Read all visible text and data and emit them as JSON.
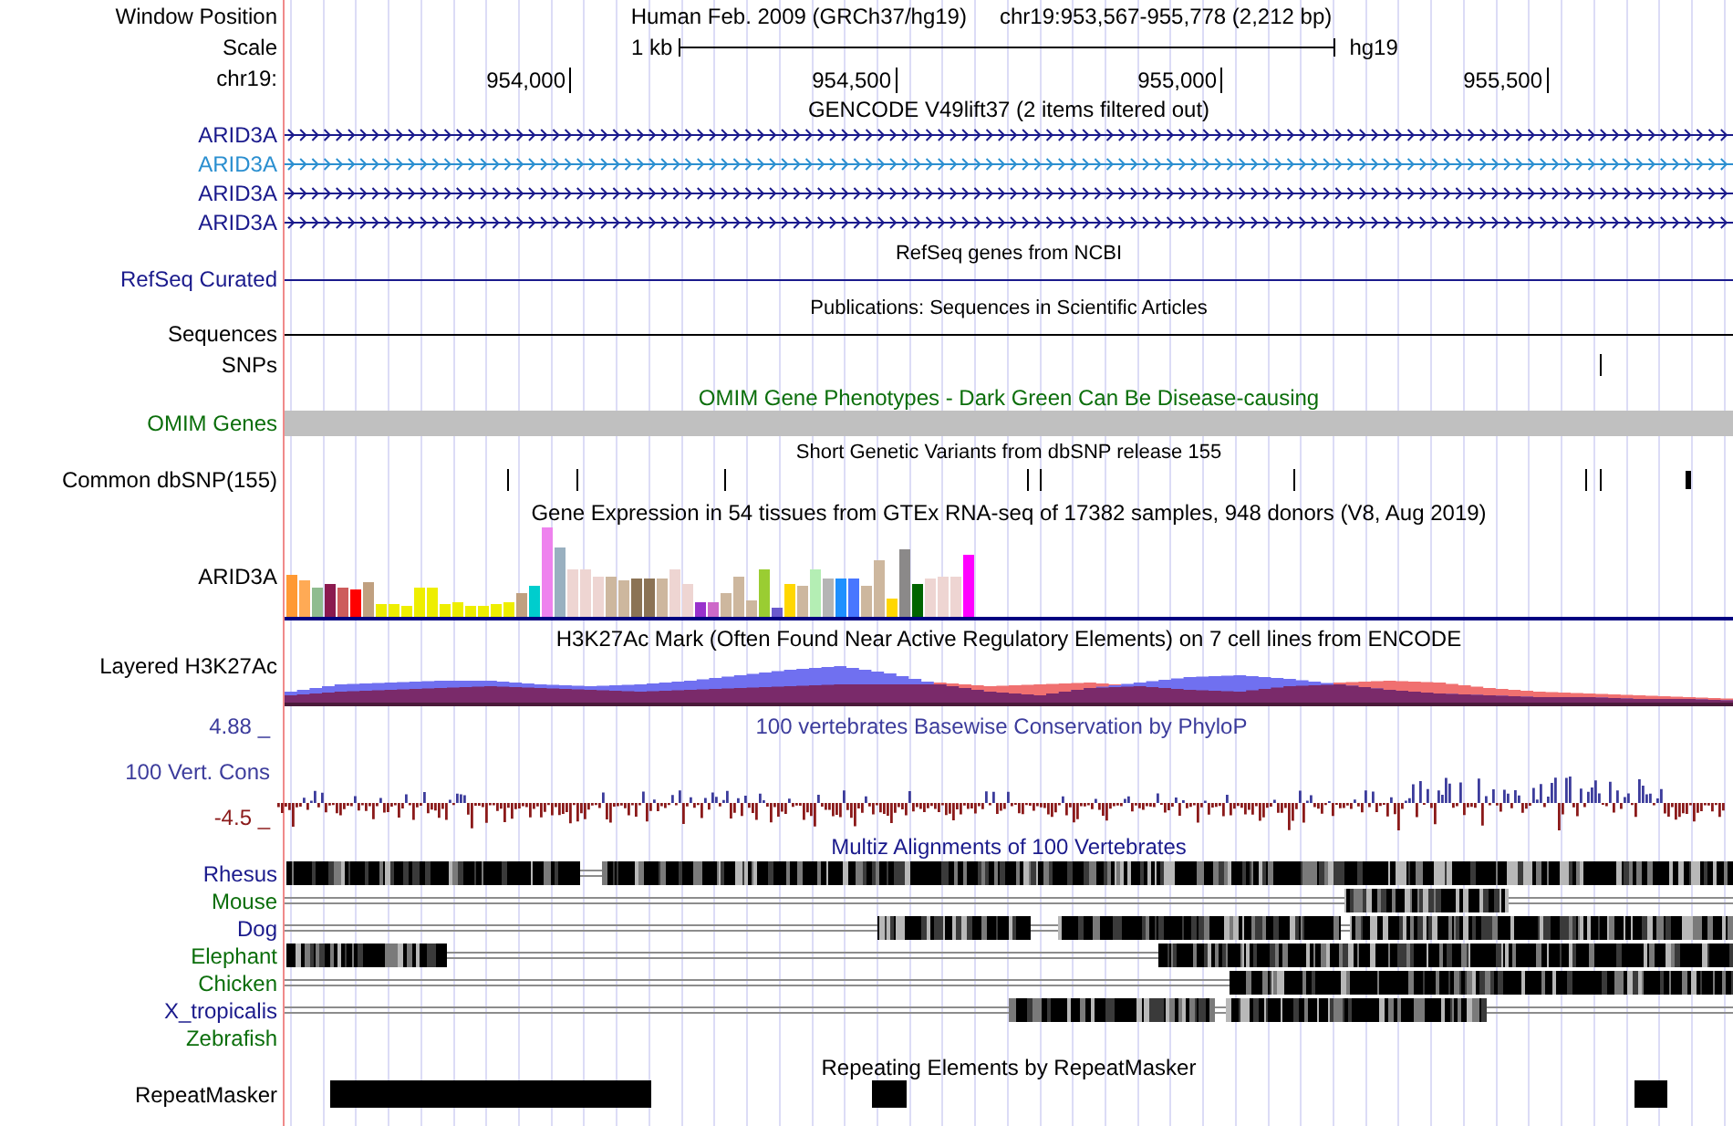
{
  "header": {
    "position_label": "Window Position",
    "assembly": "Human Feb. 2009 (GRCh37/hg19)",
    "position": "chr19:953,567-955,778 (2,212 bp)",
    "scale_label": "Scale",
    "scale_length": "1 kb",
    "scale_assembly": "hg19",
    "chrom_label": "chr19:",
    "ticks": [
      "954,000",
      "954,500",
      "955,000",
      "955,500"
    ]
  },
  "tracks": [
    {
      "kind": "genes",
      "title": "GENCODE V49lift37 (2 items filtered out)",
      "items": [
        {
          "label": "ARID3A",
          "color": "#1a1a8c"
        },
        {
          "label": "ARID3A",
          "color": "#2b8fd0"
        },
        {
          "label": "ARID3A",
          "color": "#1a1a8c"
        },
        {
          "label": "ARID3A",
          "color": "#1a1a8c"
        }
      ]
    },
    {
      "kind": "line",
      "title": "RefSeq genes from NCBI",
      "label": "RefSeq Curated",
      "color": "#1a1a8c"
    },
    {
      "kind": "line",
      "title": "Publications: Sequences in Scientific Articles",
      "label": "Sequences",
      "color": "#000000"
    },
    {
      "kind": "ticks",
      "label": "SNPs",
      "color": "#000000"
    },
    {
      "kind": "bar",
      "title": "OMIM Gene Phenotypes - Dark Green Can Be Disease-causing",
      "label": "OMIM Genes",
      "color": "#0b6e0b"
    },
    {
      "kind": "ticks",
      "title": "Short Genetic Variants from dbSNP release 155",
      "label": "Common dbSNP(155)",
      "color": "#000000"
    },
    {
      "kind": "barchart",
      "title": "Gene Expression in 54 tissues from GTEx RNA-seq of 17382 samples, 948 donors (V8, Aug 2019)",
      "label": "ARID3A",
      "color": "#000000"
    },
    {
      "kind": "layered",
      "title": "H3K27Ac Mark (Often Found Near Active Regulatory Elements) on 7 cell lines from ENCODE",
      "label": "Layered H3K27Ac",
      "color": "#000000"
    },
    {
      "kind": "wiggle",
      "title": "100 vertebrates Basewise Conservation by PhyloP",
      "label": "100 Vert. Cons",
      "color": "#3c3c9c",
      "max": "4.88 _",
      "min": "-4.5 _"
    },
    {
      "kind": "multiz",
      "title": "Multiz Alignments of 100 Vertebrates",
      "color": "#1a1a8c",
      "species": [
        {
          "label": "Rhesus",
          "color": "#1a1a8c"
        },
        {
          "label": "Mouse",
          "color": "#0b6e0b"
        },
        {
          "label": "Dog",
          "color": "#1a1a8c"
        },
        {
          "label": "Elephant",
          "color": "#0b6e0b"
        },
        {
          "label": "Chicken",
          "color": "#0b6e0b"
        },
        {
          "label": "X_tropicalis",
          "color": "#1a1a8c"
        },
        {
          "label": "Zebrafish",
          "color": "#0b6e0b"
        }
      ]
    },
    {
      "kind": "blocks",
      "title": "Repeating Elements by RepeatMasker",
      "label": "RepeatMasker",
      "color": "#000000"
    }
  ]
}
